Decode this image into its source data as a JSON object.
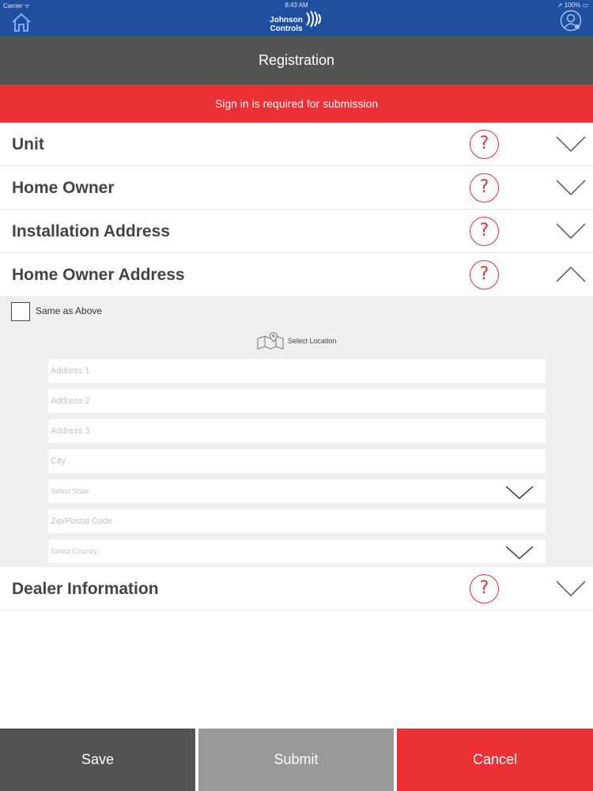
{
  "status_bar": {
    "carrier": "Carrier ᯤ",
    "time": "8:43 AM",
    "battery": "➚ 100% ▭"
  },
  "header": {
    "logo_line1": "Johnson",
    "logo_line2": "Controls",
    "home_icon": "home-icon",
    "profile_icon": "user-profile-icon"
  },
  "title": "Registration",
  "alert": "Sign in is required for submission",
  "sections": [
    {
      "title": "Unit",
      "help": "?",
      "state": "collapsed"
    },
    {
      "title": "Home Owner",
      "help": "?",
      "state": "collapsed"
    },
    {
      "title": "Installation Address",
      "help": "?",
      "state": "collapsed"
    },
    {
      "title": "Home Owner Address",
      "help": "?",
      "state": "expanded"
    },
    {
      "title": "Dealer Information",
      "help": "?",
      "state": "collapsed"
    }
  ],
  "home_owner_address": {
    "same_as_above_label": "Same as Above",
    "same_as_above_checked": false,
    "select_location_label": "Select Location",
    "fields": [
      {
        "placeholder": "Address 1",
        "type": "text"
      },
      {
        "placeholder": "Address 2",
        "type": "text"
      },
      {
        "placeholder": "Address 3",
        "type": "text"
      },
      {
        "placeholder": "City",
        "type": "text"
      },
      {
        "placeholder": "Select State",
        "type": "select"
      },
      {
        "placeholder": "Zip/Postal Code",
        "type": "text"
      },
      {
        "placeholder": "Select Country",
        "type": "select"
      }
    ]
  },
  "footer": {
    "save_label": "Save",
    "submit_label": "Submit",
    "cancel_label": "Cancel"
  },
  "colors": {
    "nav_blue": "#1f4f9e",
    "title_gray": "#545454",
    "alert_red": "#ec3136",
    "submit_gray": "#999999",
    "form_bg": "#efeff1"
  }
}
